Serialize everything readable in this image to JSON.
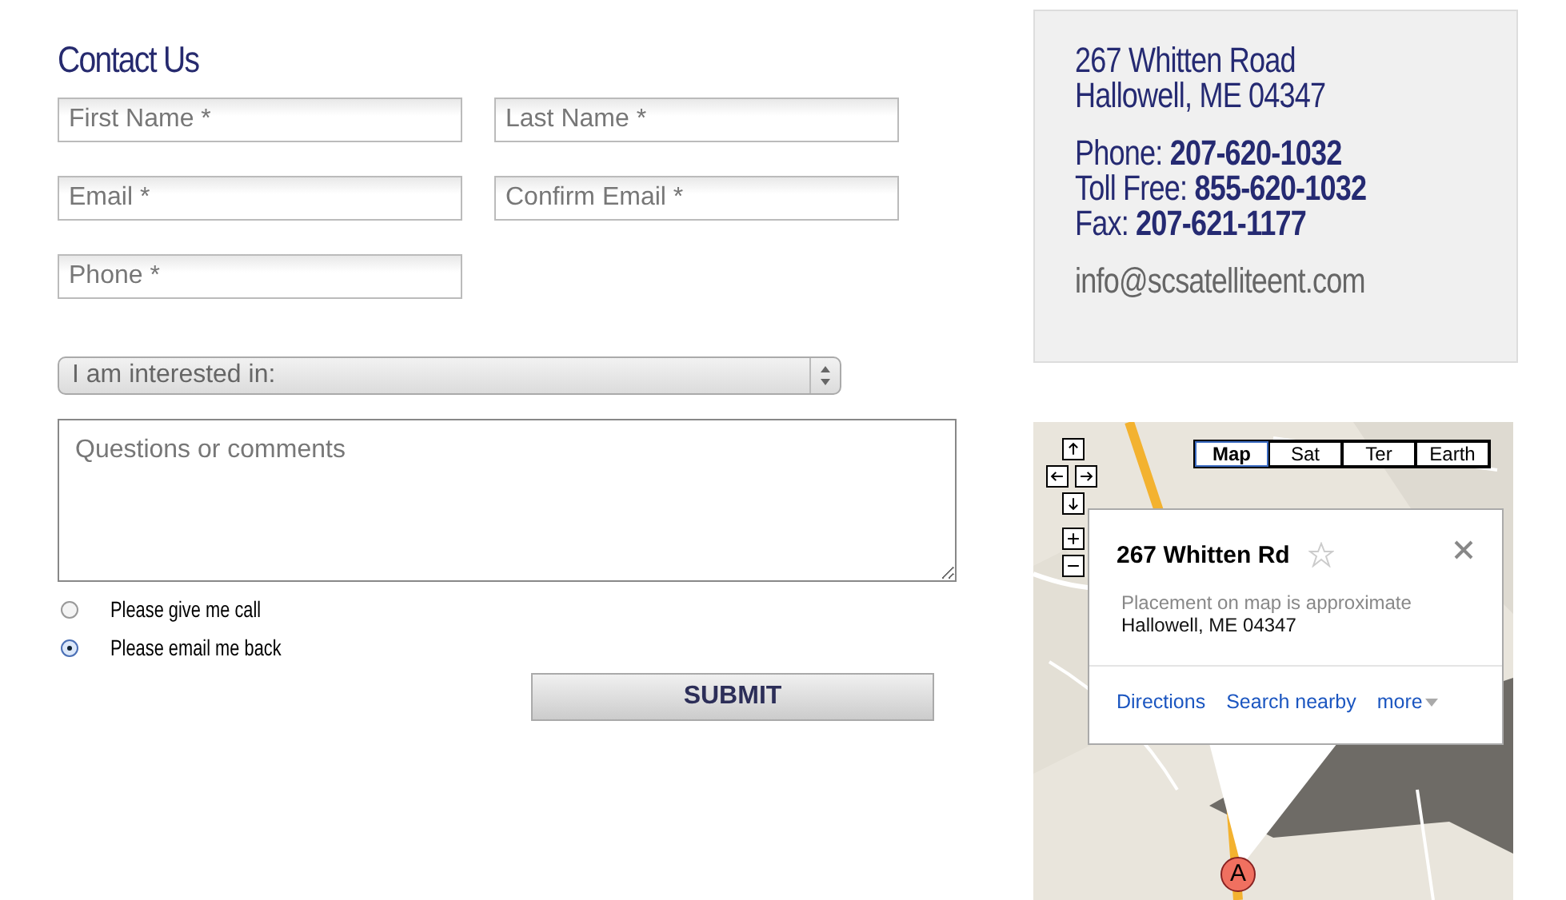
{
  "heading": "Contact Us",
  "fields": [
    {
      "placeholder": "First Name *"
    },
    {
      "placeholder": "Last Name *"
    },
    {
      "placeholder": "Email *"
    },
    {
      "placeholder": "Confirm Email *"
    },
    {
      "placeholder": "Phone *"
    }
  ],
  "select": {
    "value": "I am interested in:"
  },
  "comments": {
    "placeholder": "Questions or comments"
  },
  "contact_options": [
    {
      "label": "Please give me call",
      "selected": false
    },
    {
      "label": "Please email me back",
      "selected": true
    }
  ],
  "submit": "SUBMIT",
  "address": {
    "lines": [
      "267 Whitten Road",
      "Hallowell, ME 04347"
    ],
    "phones": [
      "Phone: **207-620-1032**",
      "Toll Free: **855-620-1032**",
      "Fax: **207-621-1177**"
    ],
    "email": "info@scsatelliteent.com"
  },
  "map": {
    "kind": "picture",
    "map_types": [
      {
        "label": "Map",
        "selected": true
      },
      {
        "label": "Sat",
        "selected": false
      },
      {
        "label": "Ter",
        "selected": false
      },
      {
        "label": "Earth",
        "selected": false
      }
    ],
    "info": {
      "title": "267 Whitten Rd",
      "note": "Placement on map is approximate",
      "address": "Hallowell, ME 04347",
      "links": [
        "Directions",
        "Search nearby",
        "more"
      ]
    },
    "marker": "A"
  }
}
